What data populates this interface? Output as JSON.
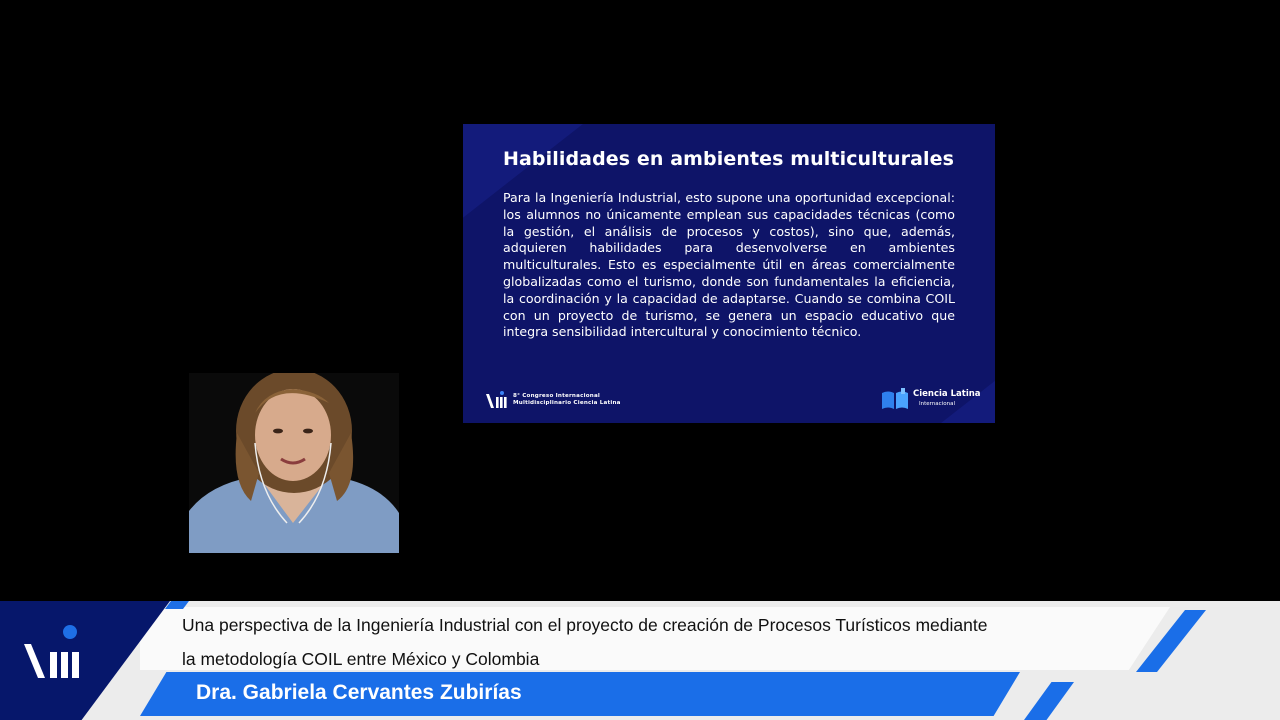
{
  "slide": {
    "title": "Habilidades en ambientes multiculturales",
    "body": "Para la Ingeniería Industrial, esto supone una oportunidad excepcional: los alumnos no únicamente emplean sus capacidades técnicas (como la gestión, el análisis de procesos y costos), sino que, además, adquieren habilidades para desenvolverse en ambientes multiculturales. Esto es especialmente útil en áreas comercialmente globalizadas como el turismo, donde son fundamentales la eficiencia, la coordinación y la capacidad de adaptarse. Cuando se combina COIL con un proyecto de turismo, se genera un espacio educativo que integra sensibilidad intercultural y conocimiento técnico.",
    "logo_left_line1": "8° Congreso Internacional",
    "logo_left_line2": "Multidisciplinario Ciencia Latina",
    "logo_right_brand": "Ciencia Latina",
    "logo_right_sub": "Internacional"
  },
  "lower_third": {
    "title_line1": "Una perspectiva de la Ingeniería Industrial con el proyecto de creación de Procesos Turísticos mediante",
    "title_line2": "la metodología COIL entre México y Colombia",
    "speaker_name": "Dra. Gabriela Cervantes Zubirías"
  },
  "colors": {
    "slide_bg": "#0e1468",
    "brand_dark_blue": "#06176b",
    "accent_blue": "#1a6ee8"
  },
  "icons": [
    "viii-logo-icon",
    "book-logo-icon",
    "speaker-video"
  ]
}
